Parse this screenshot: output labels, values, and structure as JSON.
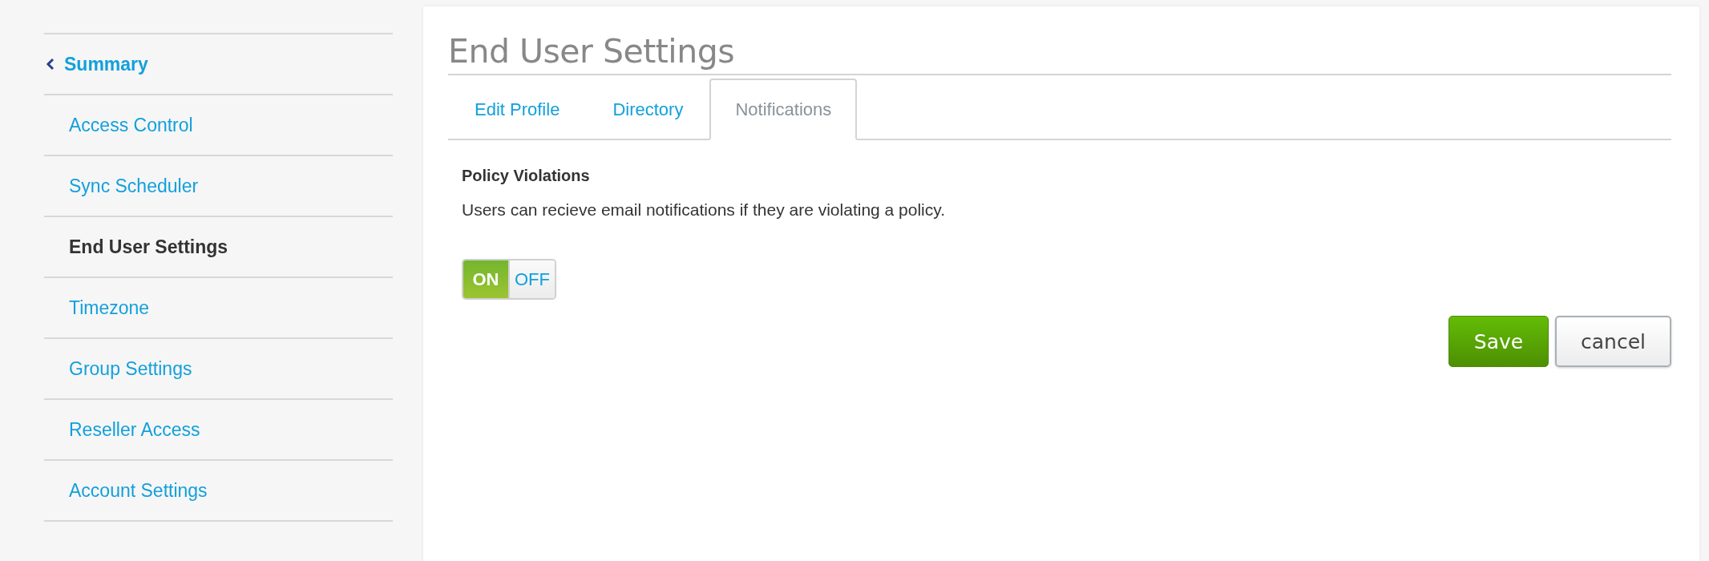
{
  "sidebar": {
    "items": [
      {
        "label": "Summary",
        "kind": "back",
        "selected": false
      },
      {
        "label": "Access Control",
        "kind": "link",
        "selected": false
      },
      {
        "label": "Sync Scheduler",
        "kind": "link",
        "selected": false
      },
      {
        "label": "End User Settings",
        "kind": "link",
        "selected": true
      },
      {
        "label": "Timezone",
        "kind": "link",
        "selected": false
      },
      {
        "label": "Group Settings",
        "kind": "link",
        "selected": false
      },
      {
        "label": "Reseller Access",
        "kind": "link",
        "selected": false
      },
      {
        "label": "Account Settings",
        "kind": "link",
        "selected": false
      }
    ]
  },
  "page": {
    "title": "End User Settings",
    "tabs": [
      {
        "label": "Edit Profile",
        "selected": false
      },
      {
        "label": "Directory",
        "selected": false
      },
      {
        "label": "Notifications",
        "selected": true
      }
    ],
    "section": {
      "heading": "Policy Violations",
      "description": "Users can recieve email notifications if they are violating a policy.",
      "toggle": {
        "on_label": "ON",
        "off_label": "OFF",
        "on": true
      }
    },
    "buttons": [
      {
        "label": "Save",
        "kind": "primary"
      },
      {
        "label": "cancel",
        "kind": "secondary"
      }
    ]
  }
}
